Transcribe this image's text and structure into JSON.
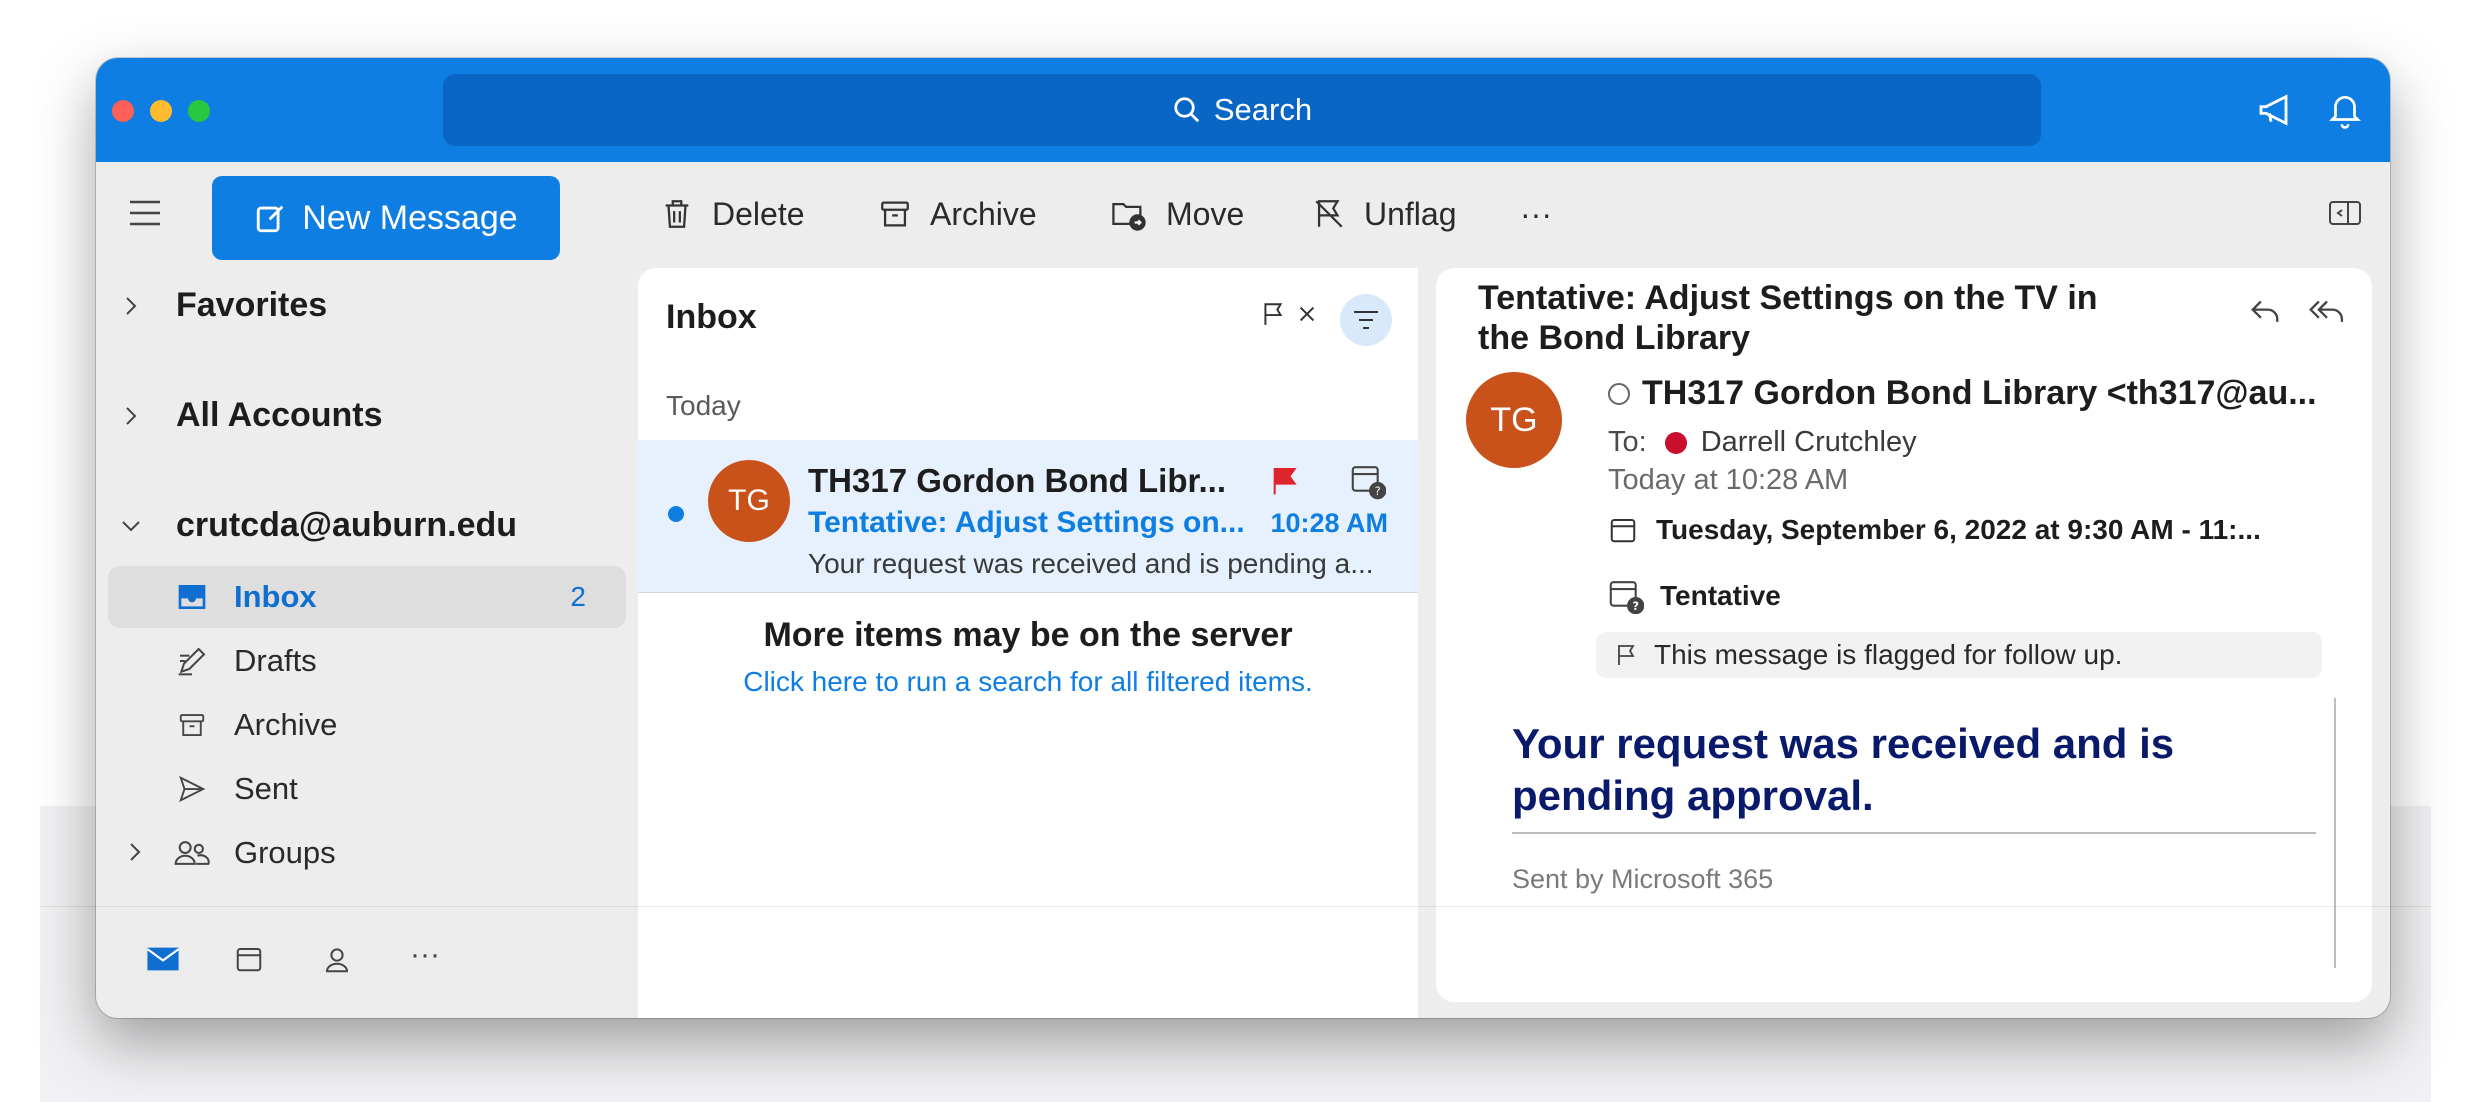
{
  "titlebar": {
    "search_label": "Search"
  },
  "toolbar": {
    "new_message": "New Message",
    "delete": "Delete",
    "archive": "Archive",
    "move": "Move",
    "unflag": "Unflag",
    "more": "···"
  },
  "sidebar": {
    "favorites": "Favorites",
    "all_accounts": "All Accounts",
    "account": "crutcda@auburn.edu",
    "folders": [
      {
        "label": "Inbox",
        "count": "2",
        "icon": "inbox-icon"
      },
      {
        "label": "Drafts",
        "icon": "drafts-icon"
      },
      {
        "label": "Archive",
        "icon": "archive-icon"
      },
      {
        "label": "Sent",
        "icon": "sent-icon"
      },
      {
        "label": "Groups",
        "icon": "groups-icon"
      }
    ],
    "bottom_more": "···"
  },
  "message_list": {
    "title": "Inbox",
    "group_label": "Today",
    "messages": [
      {
        "initials": "TG",
        "sender": "TH317 Gordon Bond Libr...",
        "subject": "Tentative: Adjust Settings on...",
        "time": "10:28 AM",
        "preview": "Your request was received and is pending a..."
      }
    ],
    "more_items": "More items may be on the server",
    "search_link": "Click here to run a search for all filtered items."
  },
  "reading_pane": {
    "subject": "Tentative: Adjust Settings on the TV in the Bond Library",
    "initials": "TG",
    "from": "TH317 Gordon Bond Library <th317@au...",
    "to_label": "To:",
    "to_name": "Darrell Crutchley",
    "date": "Today at 10:28 AM",
    "meeting_time": "Tuesday, September 6, 2022 at 9:30 AM - 11:...",
    "status": "Tentative",
    "flag_notice": "This message is flagged for follow up.",
    "body_heading": "Your request was received and is pending approval.",
    "body_footer": "Sent by Microsoft 365"
  },
  "colors": {
    "accent": "#0f7ee3",
    "titlebar": "#0f7ee3",
    "avatar": "#c9521b",
    "flag": "#e0242b",
    "body_heading": "#0a1a6b"
  }
}
